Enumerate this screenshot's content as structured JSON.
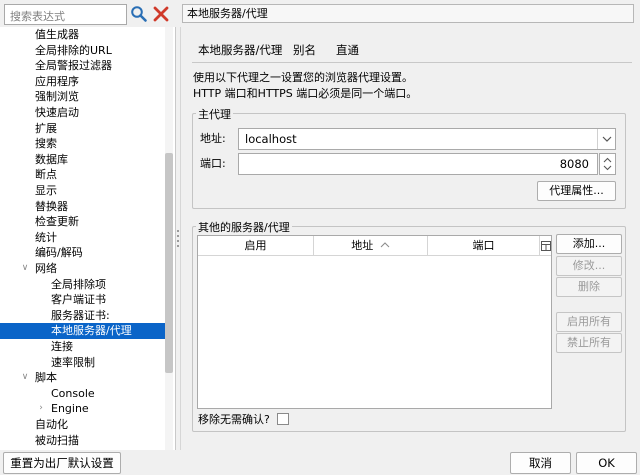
{
  "search": {
    "placeholder": "搜索表达式"
  },
  "tree": {
    "items": [
      {
        "label": "值生成器",
        "arrow": ""
      },
      {
        "label": "全局排除的URL",
        "arrow": ""
      },
      {
        "label": "全局警报过滤器",
        "arrow": ""
      },
      {
        "label": "应用程序",
        "arrow": ""
      },
      {
        "label": "强制浏览",
        "arrow": ""
      },
      {
        "label": "快速启动",
        "arrow": ""
      },
      {
        "label": "扩展",
        "arrow": ""
      },
      {
        "label": "搜索",
        "arrow": ""
      },
      {
        "label": "数据库",
        "arrow": ""
      },
      {
        "label": "断点",
        "arrow": ""
      },
      {
        "label": "显示",
        "arrow": ""
      },
      {
        "label": "替换器",
        "arrow": ""
      },
      {
        "label": "检查更新",
        "arrow": ""
      },
      {
        "label": "统计",
        "arrow": ""
      },
      {
        "label": "编码/解码",
        "arrow": ""
      },
      {
        "label": "网络",
        "arrow": "∨"
      },
      {
        "label": "全局排除项",
        "arrow": ""
      },
      {
        "label": "客户端证书",
        "arrow": ""
      },
      {
        "label": "服务器证书:",
        "arrow": ""
      },
      {
        "label": "本地服务器/代理",
        "arrow": "",
        "selected": true
      },
      {
        "label": "连接",
        "arrow": ""
      },
      {
        "label": "速率限制",
        "arrow": ""
      },
      {
        "label": "脚本",
        "arrow": "∨"
      },
      {
        "label": "Console",
        "arrow": ""
      },
      {
        "label": "Engine",
        "arrow": "›"
      },
      {
        "label": "自动化",
        "arrow": ""
      },
      {
        "label": "被动扫描",
        "arrow": ""
      }
    ]
  },
  "header": {
    "title": "本地服务器/代理"
  },
  "tabs": [
    {
      "label": "本地服务器/代理",
      "active": true
    },
    {
      "label": "别名",
      "active": false
    },
    {
      "label": "直通",
      "active": false
    }
  ],
  "description": {
    "line1": "使用以下代理之一设置您的浏览器代理设置。",
    "line2": "HTTP 端口和HTTPS 端口必须是同一个端口。"
  },
  "main_proxy": {
    "legend": "主代理",
    "address_label": "地址:",
    "address_value": "localhost",
    "port_label": "端口:",
    "port_value": "8080",
    "properties_button": "代理属性..."
  },
  "other_servers": {
    "legend": "其他的服务器/代理",
    "columns": [
      "启用",
      "地址",
      "端口"
    ],
    "rows": [],
    "buttons": {
      "add": "添加...",
      "edit": "修改...",
      "remove": "删除",
      "enable_all": "启用所有",
      "disable_all": "禁止所有"
    },
    "confirm_remove_label": "移除无需确认?"
  },
  "footer": {
    "reset_button": "重置为出厂默认设置",
    "cancel_button": "取消",
    "ok_button": "OK"
  },
  "colors": {
    "selection": "#0a64c8",
    "clear_icon": "#d03a2a",
    "search_icon": "#2a6fb5"
  }
}
